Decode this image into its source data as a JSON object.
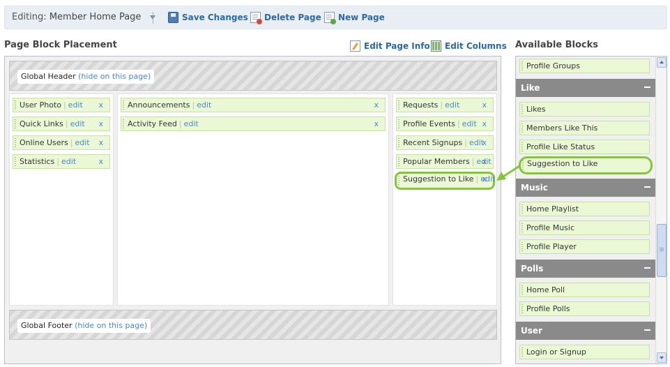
{
  "topbar": {
    "editing_label": "Editing:",
    "page_name": "Member Home Page",
    "save_label": "Save Changes",
    "delete_label": "Delete Page",
    "new_label": "New Page"
  },
  "placement": {
    "title": "Page Block Placement",
    "edit_info_label": "Edit Page Info",
    "edit_columns_label": "Edit Columns",
    "global_header": "Global Header",
    "global_footer": "Global Footer",
    "hide_link": "(hide on this page)",
    "edit_label": "edit",
    "remove_label": "x",
    "left_column": [
      "User Photo",
      "Quick Links",
      "Online Users",
      "Statistics"
    ],
    "middle_column": [
      "Announcements",
      "Activity Feed"
    ],
    "right_column": [
      "Requests",
      "Profile Events",
      "Recent Signups",
      "Popular Members",
      "Suggestion to Like"
    ]
  },
  "available": {
    "title": "Available Blocks",
    "top_item": "Profile Groups",
    "categories": [
      {
        "name": "Like",
        "items": [
          "Likes",
          "Members Like This",
          "Profile Like Status",
          "Suggestion to Like"
        ]
      },
      {
        "name": "Music",
        "items": [
          "Home Playlist",
          "Profile Music",
          "Profile Player"
        ]
      },
      {
        "name": "Polls",
        "items": [
          "Home Poll",
          "Profile Polls"
        ]
      },
      {
        "name": "User",
        "items": [
          "Login or Signup"
        ]
      }
    ]
  },
  "colors": {
    "block_bg": "#ebf8d6",
    "highlight": "#86c43a",
    "link": "#2c6a9e",
    "category_bg": "#8a8a8a"
  }
}
